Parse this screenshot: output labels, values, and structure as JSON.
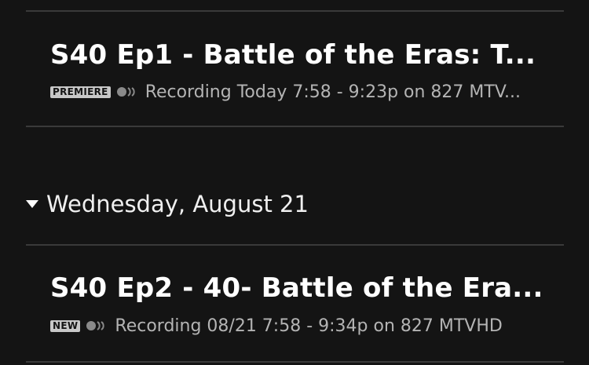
{
  "recordings": [
    {
      "title": "S40 Ep1 - Battle of the Eras: T...",
      "badge": "PREMIERE",
      "status_text": "Recording Today 7:58 - 9:23p on 827 MTV...",
      "icon": "series-recording-icon"
    },
    {
      "title": "S40 Ep2 - 40- Battle of the Era...",
      "badge": "NEW",
      "status_text": "Recording 08/21 7:58 - 9:34p on 827 MTVHD",
      "icon": "series-recording-icon"
    }
  ],
  "section": {
    "date_label": "Wednesday, August 21",
    "toggle_icon": "caret-down-icon"
  },
  "colors": {
    "background": "#141414",
    "title": "#ffffff",
    "meta_text": "#b4b4b4",
    "divider": "#3a3a3a",
    "badge_bg": "#c8c8c8"
  }
}
